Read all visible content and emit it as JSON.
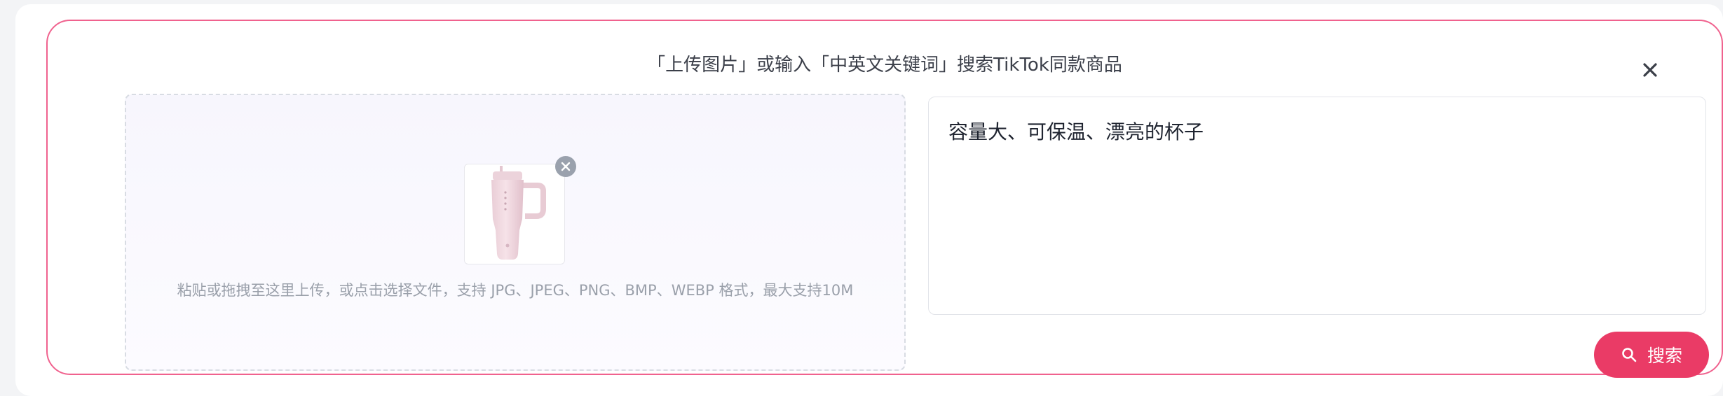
{
  "panel": {
    "title": "「上传图片」或输入「中英文关键词」搜索TikTok同款商品",
    "close_icon": "close-icon"
  },
  "upload": {
    "hint": "粘贴或拖拽至这里上传，或点击选择文件，支持 JPG、JPEG、PNG、BMP、WEBP 格式，最大支持10M",
    "thumbnail_icon": "pink-tumbler-image",
    "remove_icon": "remove-image-icon"
  },
  "keyword": {
    "value": "容量大、可保温、漂亮的杯子"
  },
  "search_button": {
    "label": "搜索",
    "icon": "search-icon"
  },
  "colors": {
    "accent": "#ea3b66",
    "panel_border": "#f0628e"
  }
}
